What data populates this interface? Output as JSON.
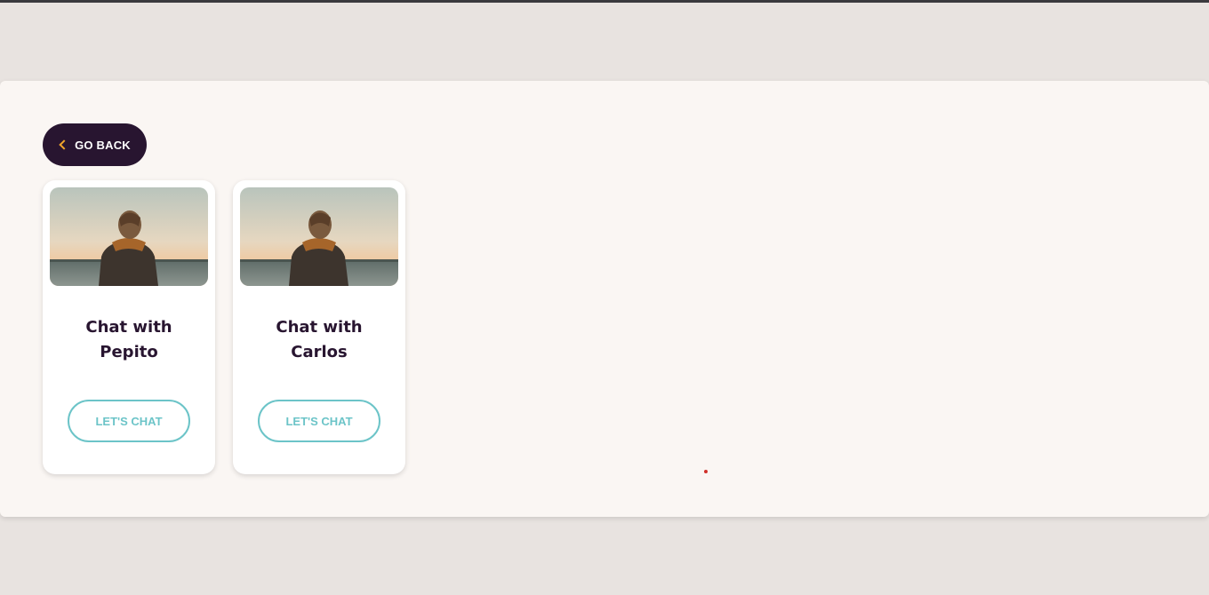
{
  "back_button": {
    "label": "GO BACK",
    "icon": "chevron-left-icon",
    "icon_color": "#f0a52b",
    "bg": "#281530"
  },
  "cards": [
    {
      "title": "Chat with Pepito",
      "button_label": "LET'S CHAT",
      "image": "person-at-seaside-photo"
    },
    {
      "title": "Chat with Carlos",
      "button_label": "LET'S CHAT",
      "image": "person-at-seaside-photo"
    }
  ],
  "colors": {
    "page_bg": "#e8e3e0",
    "panel_bg": "#faf6f3",
    "accent_teal": "#6cc4c8",
    "title_color": "#281530"
  }
}
